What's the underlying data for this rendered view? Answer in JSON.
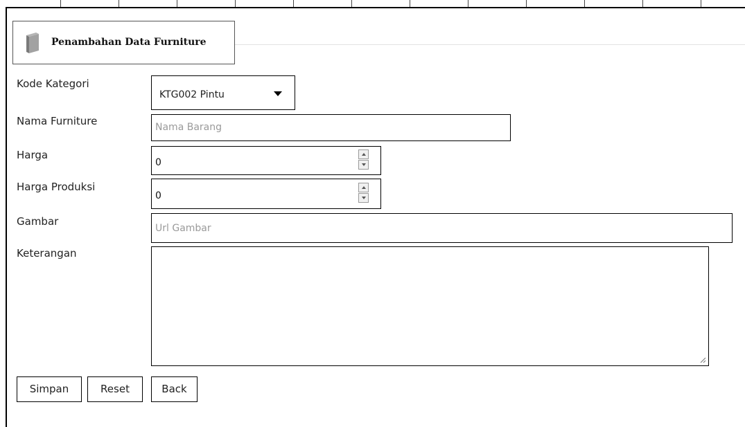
{
  "form": {
    "legend_title": "Penambahan Data Furniture",
    "legend_icon": "book-icon"
  },
  "fields": {
    "kode_kategori": {
      "label": "Kode Kategori",
      "value": "KTG002 Pintu"
    },
    "nama_furniture": {
      "label": "Nama Furniture",
      "placeholder": "Nama Barang",
      "value": ""
    },
    "harga": {
      "label": "Harga",
      "value": "0"
    },
    "harga_produksi": {
      "label": "Harga Produksi",
      "value": "0"
    },
    "gambar": {
      "label": "Gambar",
      "placeholder": "Url Gambar",
      "value": ""
    },
    "keterangan": {
      "label": "Keterangan",
      "value": ""
    }
  },
  "buttons": {
    "simpan": "Simpan",
    "reset": "Reset",
    "back": "Back"
  },
  "colors": {
    "border": "#000000",
    "placeholder": "#9a9a9a"
  }
}
